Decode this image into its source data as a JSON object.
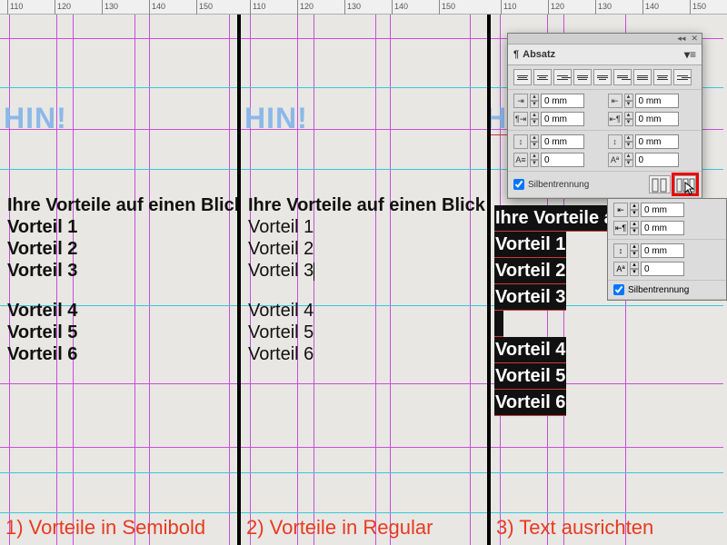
{
  "ruler": {
    "labels": [
      "110",
      "120",
      "130",
      "140",
      "150",
      "110",
      "120",
      "130",
      "140",
      "150",
      "110",
      "120",
      "130",
      "140",
      "150"
    ]
  },
  "panel": {
    "title": "Absatz",
    "topbar_collapse": "◂◂",
    "topbar_close": "✕",
    "menu_glyph": "▾≡",
    "indent_label": "0 mm",
    "zero_label": "0",
    "hyphen_label": "Silbentrennung",
    "hyphen_checked": true
  },
  "content": {
    "hin": "HIN!",
    "headline": "Ihre Vorteile auf einen Blick",
    "lines_top": [
      "Vorteil 1",
      "Vorteil 2",
      "Vorteil 3"
    ],
    "lines_bottom": [
      "Vorteil 4",
      "Vorteil 5",
      "Vorteil 6"
    ]
  },
  "col3_headline": "Ihre Vorteile auf",
  "captions": {
    "c1": "1) Vorteile in Semibold",
    "c2": "2) Vorteile in Regular",
    "c3": "3) Text ausrichten"
  }
}
